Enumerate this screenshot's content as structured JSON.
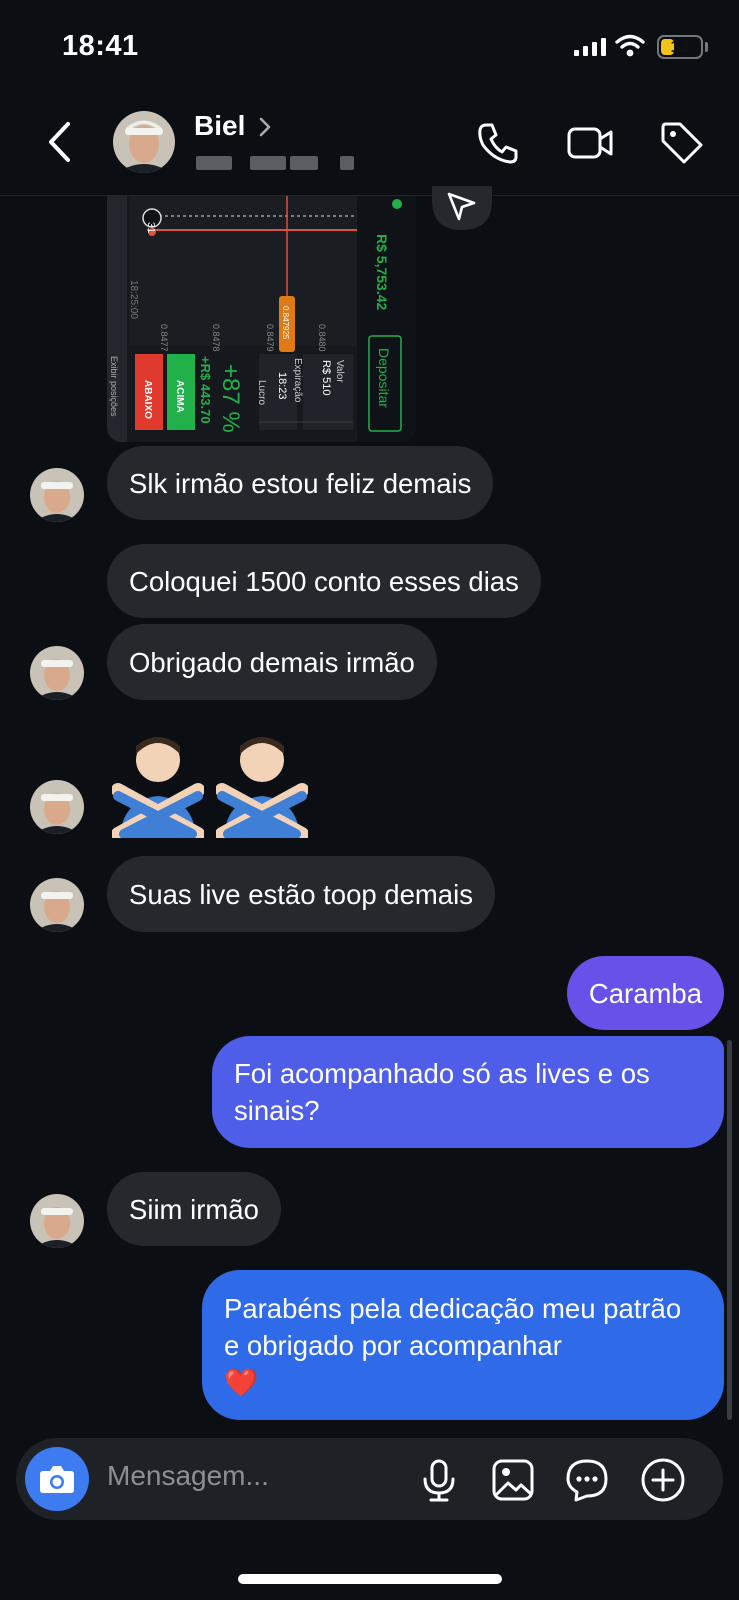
{
  "status_bar": {
    "time": "18:41",
    "battery": "13"
  },
  "header": {
    "contact_name": "Biel"
  },
  "media_preview": {
    "balance": "R$ 5,753.42",
    "deposit_label": "Depositar",
    "profit": "+R$ 443.70",
    "percent": "+87 %",
    "profit_label": "Lucro",
    "expiry_label": "Expiração",
    "expiry_time": "18:23",
    "value_label": "Valor",
    "value_amount": "R$ 510",
    "up_label": "ACIMA",
    "down_label": "ABAIXO",
    "positions_label": "Exibir posições",
    "time_label": "18:25:00",
    "badge": "31",
    "price_label": "0.847925",
    "price_ticks": [
      "0.8477",
      "0.8478",
      "0.8479",
      "0.8480"
    ]
  },
  "messages": [
    {
      "id": "m1",
      "side": "in",
      "text": "Slk irmão estou feliz demais"
    },
    {
      "id": "m2",
      "side": "in",
      "text": "Coloquei 1500 conto esses dias"
    },
    {
      "id": "m3",
      "side": "in",
      "text": "Obrigado demais irmão"
    },
    {
      "id": "m4",
      "side": "in",
      "text": "Suas live estão toop demais"
    },
    {
      "id": "m5",
      "side": "out",
      "text": "Caramba"
    },
    {
      "id": "m6",
      "side": "out",
      "text": "Foi acompanhado só as lives e os sinais?"
    },
    {
      "id": "m7",
      "side": "in",
      "text": "Siim irmão"
    },
    {
      "id": "m8",
      "side": "out",
      "text": "Parabéns pela dedicação meu patrão e obrigado por acompanhar",
      "emoji": "❤️"
    }
  ],
  "composer": {
    "placeholder": "Mensagem..."
  },
  "colors": {
    "background": "#0b0f14",
    "incoming_bubble": "#26282d",
    "outgoing_top": "#6652e8",
    "outgoing_bottom": "#2f6ae8",
    "camera_button": "#3d7bf0",
    "buy_green": "#22b04b",
    "sell_red": "#e03a2e"
  },
  "icons": [
    "back-chevron-icon",
    "phone-icon",
    "video-camera-icon",
    "tag-icon",
    "share-arrow-icon",
    "camera-icon",
    "microphone-icon",
    "image-icon",
    "sticker-chat-icon",
    "plus-circle-icon",
    "person-gesturing-no-emoji",
    "red-heart-emoji"
  ]
}
